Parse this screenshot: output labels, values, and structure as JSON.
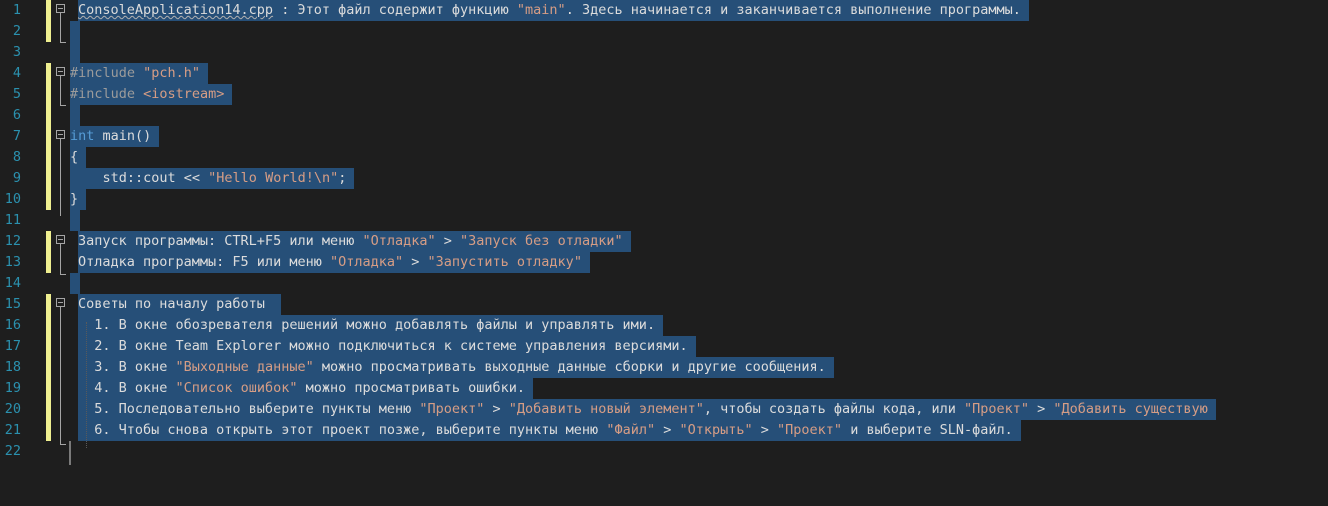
{
  "editor": {
    "lines": [
      {
        "n": "1",
        "segments": [
          {
            "t": "ConsoleApplication14.cpp",
            "c": "c-comment squiggle"
          },
          {
            "t": " : Этот файл содержит функцию ",
            "c": "c-comment"
          },
          {
            "t": "\"main\"",
            "c": "c-str"
          },
          {
            "t": ". Здесь начинается и заканчивается выполнение программы.",
            "c": "c-comment"
          }
        ]
      },
      {
        "n": "2",
        "segments": []
      },
      {
        "n": "3",
        "segments": []
      },
      {
        "n": "4",
        "segments": [
          {
            "t": "#include ",
            "c": "c-pp"
          },
          {
            "t": "\"pch.h\"",
            "c": "c-inc"
          }
        ]
      },
      {
        "n": "5",
        "segments": [
          {
            "t": "#include ",
            "c": "c-pp"
          },
          {
            "t": "<iostream>",
            "c": "c-inc"
          }
        ]
      },
      {
        "n": "6",
        "segments": []
      },
      {
        "n": "7",
        "segments": [
          {
            "t": "int",
            "c": "c-kw"
          },
          {
            "t": " main()",
            "c": "c-comment"
          }
        ]
      },
      {
        "n": "8",
        "segments": [
          {
            "t": "{",
            "c": "c-comment"
          }
        ]
      },
      {
        "n": "9",
        "segments": [
          {
            "t": "    std::cout << ",
            "c": "c-comment"
          },
          {
            "t": "\"Hello World!\\n\"",
            "c": "c-str"
          },
          {
            "t": ";",
            "c": "c-comment"
          }
        ]
      },
      {
        "n": "10",
        "segments": [
          {
            "t": "}",
            "c": "c-comment"
          }
        ]
      },
      {
        "n": "11",
        "segments": []
      },
      {
        "n": "12",
        "segments": [
          {
            "t": "Запуск программы: CTRL+F5 или меню ",
            "c": "c-comment"
          },
          {
            "t": "\"Отладка\"",
            "c": "c-str"
          },
          {
            "t": " > ",
            "c": "c-comment"
          },
          {
            "t": "\"Запуск без отладки\"",
            "c": "c-str"
          }
        ]
      },
      {
        "n": "13",
        "segments": [
          {
            "t": "Отладка программы: F5 или меню ",
            "c": "c-comment"
          },
          {
            "t": "\"Отладка\"",
            "c": "c-str"
          },
          {
            "t": " > ",
            "c": "c-comment"
          },
          {
            "t": "\"Запустить отладку\"",
            "c": "c-str"
          }
        ]
      },
      {
        "n": "14",
        "segments": []
      },
      {
        "n": "15",
        "segments": [
          {
            "t": "Советы по началу работы ",
            "c": "c-comment"
          }
        ]
      },
      {
        "n": "16",
        "segments": [
          {
            "t": "  1. В окне обозревателя решений можно добавлять файлы и управлять ими.",
            "c": "c-comment"
          }
        ]
      },
      {
        "n": "17",
        "segments": [
          {
            "t": "  2. В окне Team Explorer можно подключиться к системе управления версиями.",
            "c": "c-comment"
          }
        ]
      },
      {
        "n": "18",
        "segments": [
          {
            "t": "  3. В окне ",
            "c": "c-comment"
          },
          {
            "t": "\"Выходные данные\"",
            "c": "c-str"
          },
          {
            "t": " можно просматривать выходные данные сборки и другие сообщения.",
            "c": "c-comment"
          }
        ]
      },
      {
        "n": "19",
        "segments": [
          {
            "t": "  4. В окне ",
            "c": "c-comment"
          },
          {
            "t": "\"Список ошибок\"",
            "c": "c-str"
          },
          {
            "t": " можно просматривать ошибки.",
            "c": "c-comment"
          }
        ]
      },
      {
        "n": "20",
        "segments": [
          {
            "t": "  5. Последовательно выберите пункты меню ",
            "c": "c-comment"
          },
          {
            "t": "\"Проект\"",
            "c": "c-str"
          },
          {
            "t": " > ",
            "c": "c-comment"
          },
          {
            "t": "\"Добавить новый элемент\"",
            "c": "c-str"
          },
          {
            "t": ", чтобы создать файлы кода, или ",
            "c": "c-comment"
          },
          {
            "t": "\"Проект\"",
            "c": "c-str"
          },
          {
            "t": " > ",
            "c": "c-comment"
          },
          {
            "t": "\"Добавить существую",
            "c": "c-str"
          }
        ]
      },
      {
        "n": "21",
        "segments": [
          {
            "t": "  6. Чтобы снова открыть этот проект позже, выберите пункты меню ",
            "c": "c-comment"
          },
          {
            "t": "\"Файл\"",
            "c": "c-str"
          },
          {
            "t": " > ",
            "c": "c-comment"
          },
          {
            "t": "\"Открыть\"",
            "c": "c-str"
          },
          {
            "t": " > ",
            "c": "c-comment"
          },
          {
            "t": "\"Проект\"",
            "c": "c-str"
          },
          {
            "t": " и выберите SLN-файл.",
            "c": "c-comment"
          }
        ]
      },
      {
        "n": "22",
        "segments": []
      }
    ]
  }
}
